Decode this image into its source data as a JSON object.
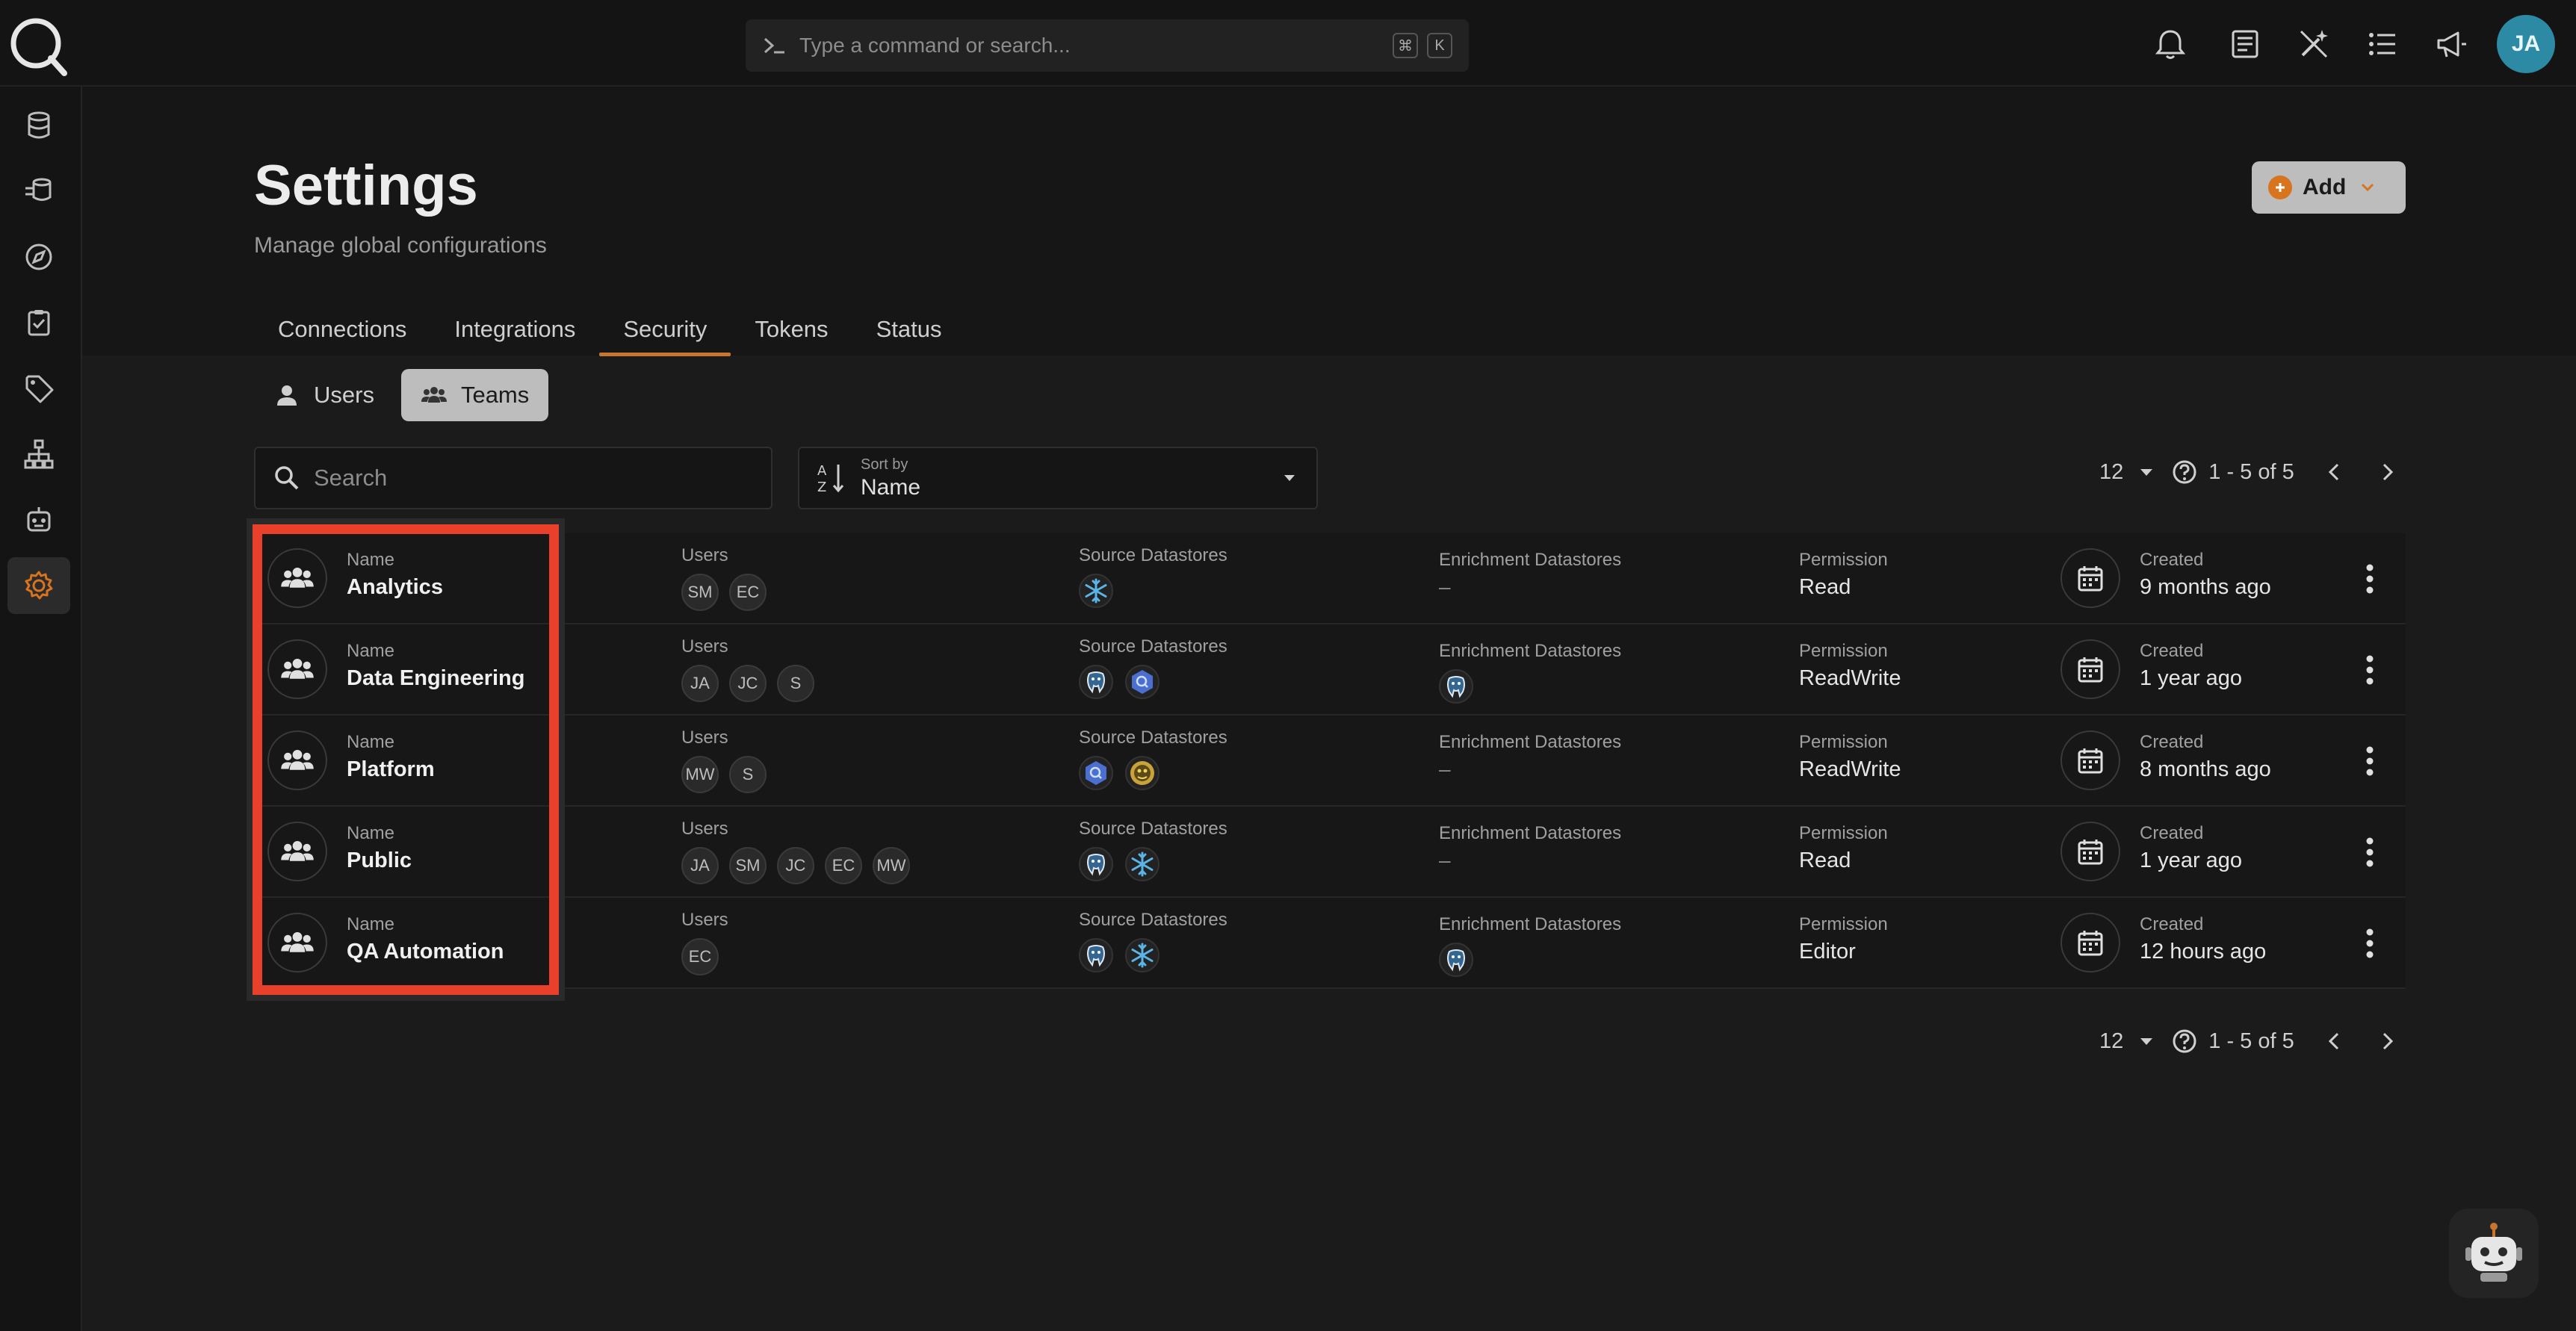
{
  "command_bar": {
    "placeholder": "Type a command or search...",
    "shortcut_mod": "⌘",
    "shortcut_key": "K"
  },
  "user": {
    "initials": "JA"
  },
  "header": {
    "title": "Settings",
    "subtitle": "Manage global configurations",
    "add_label": "Add"
  },
  "tabs": [
    {
      "label": "Connections"
    },
    {
      "label": "Integrations"
    },
    {
      "label": "Security",
      "active": true
    },
    {
      "label": "Tokens"
    },
    {
      "label": "Status"
    }
  ],
  "toggle": {
    "users_label": "Users",
    "teams_label": "Teams"
  },
  "search": {
    "placeholder": "Search"
  },
  "sort": {
    "label": "Sort by",
    "value": "Name"
  },
  "pagination": {
    "page_size": "12",
    "range": "1 - 5 of 5"
  },
  "columns": {
    "name": "Name",
    "users": "Users",
    "source": "Source Datastores",
    "enrichment": "Enrichment Datastores",
    "permission": "Permission",
    "created": "Created"
  },
  "teams": [
    {
      "name": "Analytics",
      "users": [
        "SM",
        "EC"
      ],
      "source": [
        "snowflake"
      ],
      "enrichment": [],
      "enrichment_empty": "–",
      "permission": "Read",
      "created": "9 months ago"
    },
    {
      "name": "Data Engineering",
      "users": [
        "JA",
        "JC",
        "S"
      ],
      "source": [
        "postgres",
        "bigquery"
      ],
      "enrichment": [
        "postgres"
      ],
      "enrichment_empty": "",
      "permission": "ReadWrite",
      "created": "1 year ago"
    },
    {
      "name": "Platform",
      "users": [
        "MW",
        "S"
      ],
      "source": [
        "bigquery",
        "hive"
      ],
      "enrichment": [],
      "enrichment_empty": "–",
      "permission": "ReadWrite",
      "created": "8 months ago"
    },
    {
      "name": "Public",
      "users": [
        "JA",
        "SM",
        "JC",
        "EC",
        "MW"
      ],
      "source": [
        "postgres",
        "snowflake"
      ],
      "enrichment": [],
      "enrichment_empty": "–",
      "permission": "Read",
      "created": "1 year ago"
    },
    {
      "name": "QA Automation",
      "users": [
        "EC"
      ],
      "source": [
        "postgres",
        "snowflake"
      ],
      "enrichment": [
        "postgres"
      ],
      "enrichment_empty": "",
      "permission": "Editor",
      "created": "12 hours ago"
    }
  ],
  "colors": {
    "accent": "#c8752f",
    "highlight": "#e8402a",
    "avatar": "#2d8aa4"
  }
}
